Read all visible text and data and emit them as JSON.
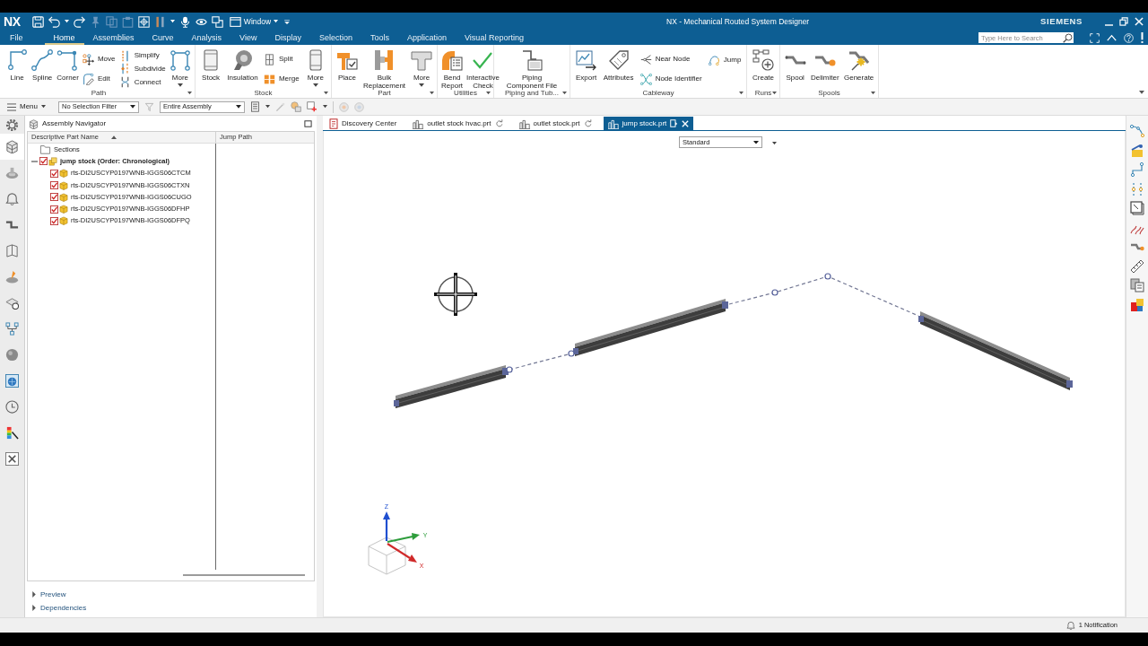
{
  "window": {
    "logo": "NX",
    "window_menu": "Window",
    "title": "NX - Mechanical Routed System Designer",
    "brand": "SIEMENS"
  },
  "ribbon_tabs": [
    {
      "label": "File",
      "selected": false
    },
    {
      "label": "Home",
      "selected": true
    },
    {
      "label": "Assemblies",
      "selected": false
    },
    {
      "label": "Curve",
      "selected": false
    },
    {
      "label": "Analysis",
      "selected": false
    },
    {
      "label": "View",
      "selected": false
    },
    {
      "label": "Display",
      "selected": false
    },
    {
      "label": "Selection",
      "selected": false
    },
    {
      "label": "Tools",
      "selected": false
    },
    {
      "label": "Application",
      "selected": false
    },
    {
      "label": "Visual Reporting",
      "selected": false
    }
  ],
  "search": {
    "placeholder": "Type Here to Search"
  },
  "ribbon_groups": [
    {
      "label": "Path",
      "columns": [
        {
          "kind": "large",
          "label": "Line"
        },
        {
          "kind": "large",
          "label": "Spline"
        },
        {
          "kind": "large",
          "label": "Corner"
        },
        {
          "kind": "stack",
          "items": [
            "Move",
            "Edit"
          ]
        },
        {
          "kind": "stack",
          "items": [
            "Simplify",
            "Subdivide",
            "Connect"
          ]
        },
        {
          "kind": "more",
          "label": "More"
        }
      ]
    },
    {
      "label": "Stock",
      "columns": [
        {
          "kind": "large",
          "label": "Stock"
        },
        {
          "kind": "large",
          "label": "Insulation"
        },
        {
          "kind": "stack",
          "items": [
            "Split",
            "Merge"
          ]
        },
        {
          "kind": "more",
          "label": "More"
        }
      ]
    },
    {
      "label": "Part",
      "columns": [
        {
          "kind": "large",
          "label": "Place"
        },
        {
          "kind": "large",
          "label": "Bulk Replacement"
        },
        {
          "kind": "more",
          "label": "More"
        }
      ]
    },
    {
      "label": "Utilities",
      "columns": [
        {
          "kind": "large",
          "label": "Bend Report"
        },
        {
          "kind": "large",
          "label": "Interactive Check"
        }
      ]
    },
    {
      "label": "Piping and Tub...",
      "columns": [
        {
          "kind": "large",
          "label": "Piping Component File"
        }
      ]
    },
    {
      "label": "Cableway",
      "columns": [
        {
          "kind": "large",
          "label": "Export"
        },
        {
          "kind": "large",
          "label": "Attributes"
        },
        {
          "kind": "stack",
          "items": [
            "Near Node",
            "Node Identifier"
          ]
        },
        {
          "kind": "stack",
          "items": [
            "Jump"
          ]
        }
      ]
    },
    {
      "label": "Runs",
      "columns": [
        {
          "kind": "large",
          "label": "Create"
        }
      ]
    },
    {
      "label": "Spools",
      "columns": [
        {
          "kind": "large",
          "label": "Spool"
        },
        {
          "kind": "large",
          "label": "Delimiter"
        },
        {
          "kind": "large",
          "label": "Generate"
        }
      ]
    }
  ],
  "command_bar": {
    "menu": "Menu",
    "selection_filter": "No Selection Filter",
    "scope": "Entire Assembly"
  },
  "resource_bar": [
    {
      "selected": false
    },
    {
      "selected": true
    },
    {
      "selected": false
    },
    {
      "selected": false
    },
    {
      "selected": false
    },
    {
      "selected": false
    },
    {
      "selected": false
    },
    {
      "selected": false
    },
    {
      "selected": false
    },
    {
      "selected": false
    },
    {
      "selected": false
    },
    {
      "selected": false
    },
    {
      "selected": false
    },
    {
      "selected": false
    }
  ],
  "navigator": {
    "title": "Assembly Navigator",
    "columns": [
      {
        "label": "Descriptive Part Name",
        "sorted": true
      },
      {
        "label": "Jump Path",
        "sorted": false
      }
    ],
    "tree": [
      {
        "label": "Sections",
        "kind": "folder"
      },
      {
        "label": "jump stock (Order: Chronological)",
        "kind": "assembly",
        "checked": true,
        "expanded": true,
        "children": [
          {
            "label": "rts-DI2USCYP0197WNB-IGGS06CTCM",
            "kind": "part",
            "checked": true
          },
          {
            "label": "rts-DI2USCYP0197WNB-IGGS06CTXN",
            "kind": "part",
            "checked": true
          },
          {
            "label": "rts-DI2USCYP0197WNB-IGGS06CUGO",
            "kind": "part",
            "checked": true
          },
          {
            "label": "rts-DI2USCYP0197WNB-IGGS06DFHP",
            "kind": "part",
            "checked": true
          },
          {
            "label": "rts-DI2USCYP0197WNB-IGGS06DFPQ",
            "kind": "part",
            "checked": true
          }
        ]
      }
    ]
  },
  "panels": [
    {
      "label": "Preview",
      "expanded": false
    },
    {
      "label": "Dependencies",
      "expanded": false
    }
  ],
  "document_tabs": [
    {
      "label": "Discovery Center",
      "kind": "home",
      "selected": false
    },
    {
      "label": "outlet stock hvac.prt",
      "kind": "part",
      "selected": false
    },
    {
      "label": "outlet stock.prt",
      "kind": "part",
      "selected": false
    },
    {
      "label": "jump stock.prt",
      "kind": "part",
      "selected": true
    }
  ],
  "viewport": {
    "orientation": "Standard",
    "triad": {
      "z": "Z",
      "y": "Y",
      "x": "X"
    }
  },
  "status_bar": {
    "notifications": "1 Notification"
  }
}
